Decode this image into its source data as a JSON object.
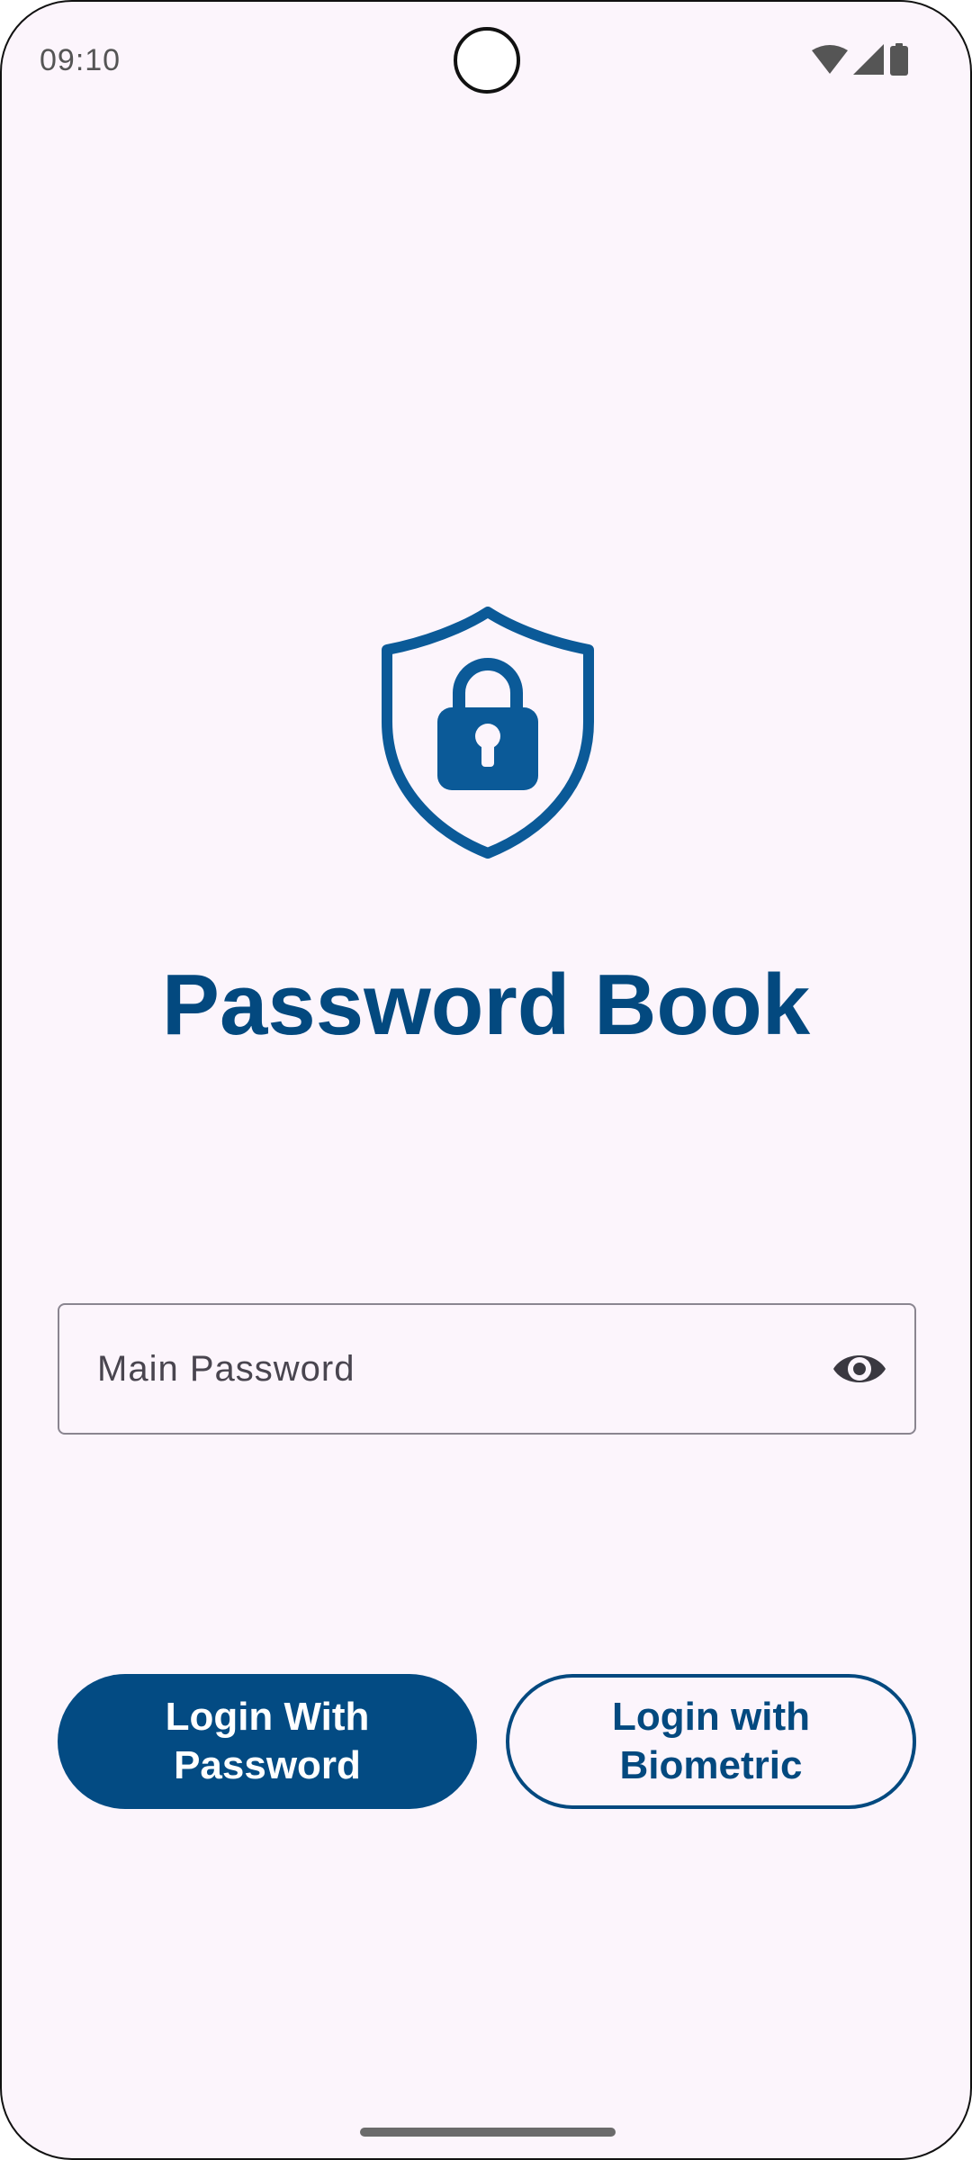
{
  "status_bar": {
    "time": "09:10",
    "icons": [
      "wifi-icon",
      "cellular-signal-icon",
      "battery-icon"
    ]
  },
  "app": {
    "logo_icon": "shield-lock-icon",
    "title": "Password Book"
  },
  "password_field": {
    "placeholder": "Main Password",
    "value": "",
    "toggle_icon": "eye-icon"
  },
  "buttons": {
    "login_password_label": "Login With Password",
    "login_biometric_label": "Login with Biometric"
  },
  "colors": {
    "primary": "#034b83",
    "background": "#fcf5fc",
    "outline": "#8a8590"
  }
}
